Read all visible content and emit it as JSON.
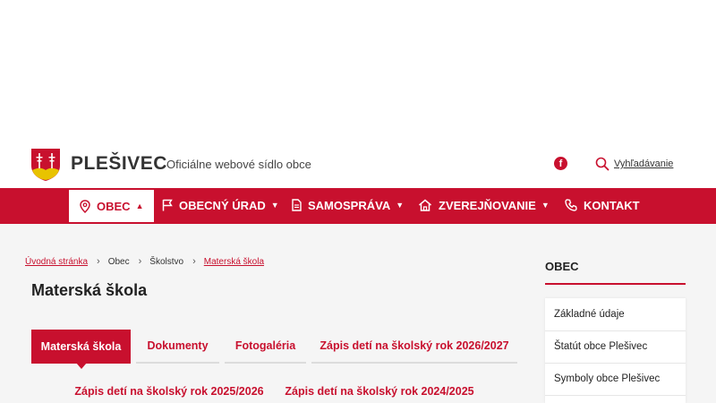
{
  "header": {
    "site_name": "PLEŠIVEC",
    "tagline": "Oficiálne webové sídlo obce",
    "search_label": "Vyhľadávanie",
    "facebook_glyph": "f"
  },
  "nav": {
    "items": [
      {
        "label": "OBEC",
        "icon": "location-pin-icon",
        "caret": "▲"
      },
      {
        "label": "OBECNÝ ÚRAD",
        "icon": "flag-icon",
        "caret": "▼"
      },
      {
        "label": "SAMOSPRÁVA",
        "icon": "document-icon",
        "caret": "▼"
      },
      {
        "label": "ZVEREJŇOVANIE",
        "icon": "home-icon",
        "caret": "▼"
      },
      {
        "label": "KONTAKT",
        "icon": "phone-icon"
      }
    ]
  },
  "breadcrumb": {
    "items": [
      "Úvodná stránka",
      "Obec",
      "Školstvo",
      "Materská škola"
    ],
    "separator": "›"
  },
  "page_title": "Materská škola",
  "tabs": [
    "Materská škola",
    "Dokumenty",
    "Fotogaléria",
    "Zápis detí na školský rok 2026/2027",
    "Zápis detí na školský rok 2025/2026",
    "Zápis detí na školský rok 2024/2025"
  ],
  "sidebar": {
    "title": "OBEC",
    "items": [
      "Základné údaje",
      "Štatút obce Plešivec",
      "Symboly obce Plešivec"
    ]
  },
  "colors": {
    "brand": "#c8102e",
    "background": "#f5f5f5"
  }
}
